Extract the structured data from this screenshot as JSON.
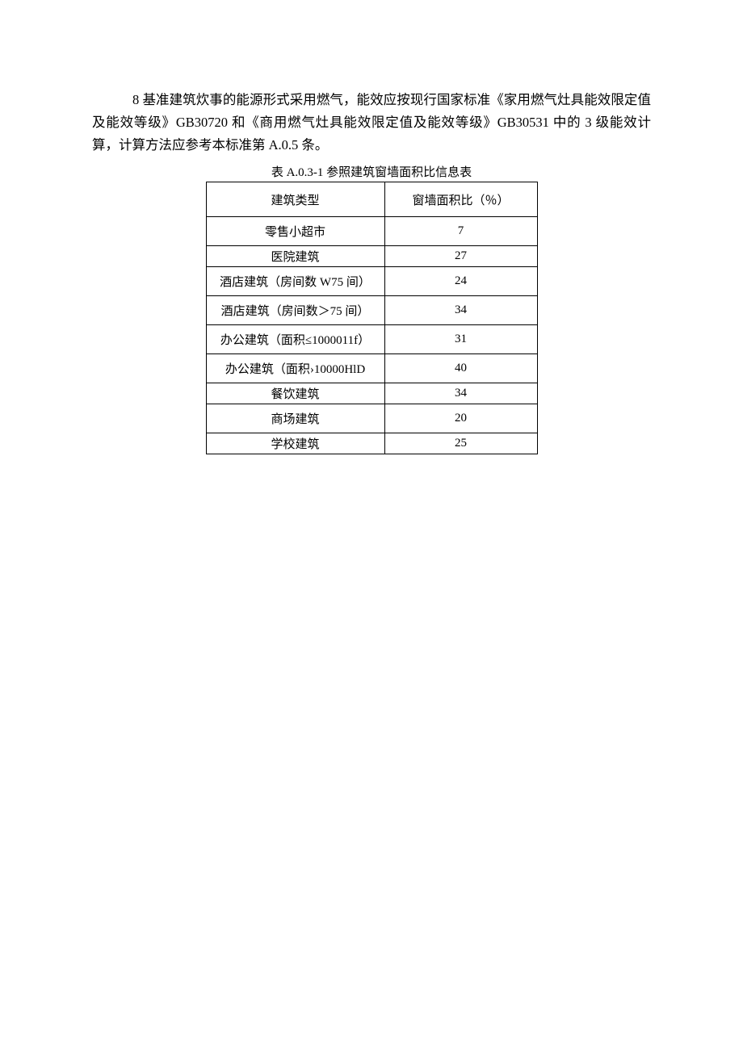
{
  "paragraph": {
    "text": "8 基准建筑炊事的能源形式采用燃气，能效应按现行国家标准《家用燃气灶具能效限定值及能效等级》GB30720 和《商用燃气灶具能效限定值及能效等级》GB30531 中的 3 级能效计算，计算方法应参考本标准第 A.0.5 条。"
  },
  "table": {
    "caption": "表 A.0.3-1 参照建筑窗墙面积比信息表",
    "header": {
      "type": "建筑类型",
      "ratio": "窗墙面积比（％）"
    },
    "rows": [
      {
        "type": "零售小超市",
        "ratio": "7",
        "tall": true
      },
      {
        "type": "医院建筑",
        "ratio": "27",
        "tall": false
      },
      {
        "type": "酒店建筑（房间数 W75 间）",
        "ratio": "24",
        "tall": true
      },
      {
        "type": "酒店建筑（房间数＞75 间）",
        "ratio": "34",
        "tall": true
      },
      {
        "type": "办公建筑（面积≤1000011f）",
        "ratio": "31",
        "tall": true
      },
      {
        "type": "办公建筑（面积›10000HlD",
        "ratio": "40",
        "tall": true
      },
      {
        "type": "餐饮建筑",
        "ratio": "34",
        "tall": false
      },
      {
        "type": "商场建筑",
        "ratio": "20",
        "tall": true
      },
      {
        "type": "学校建筑",
        "ratio": "25",
        "tall": false
      }
    ]
  }
}
